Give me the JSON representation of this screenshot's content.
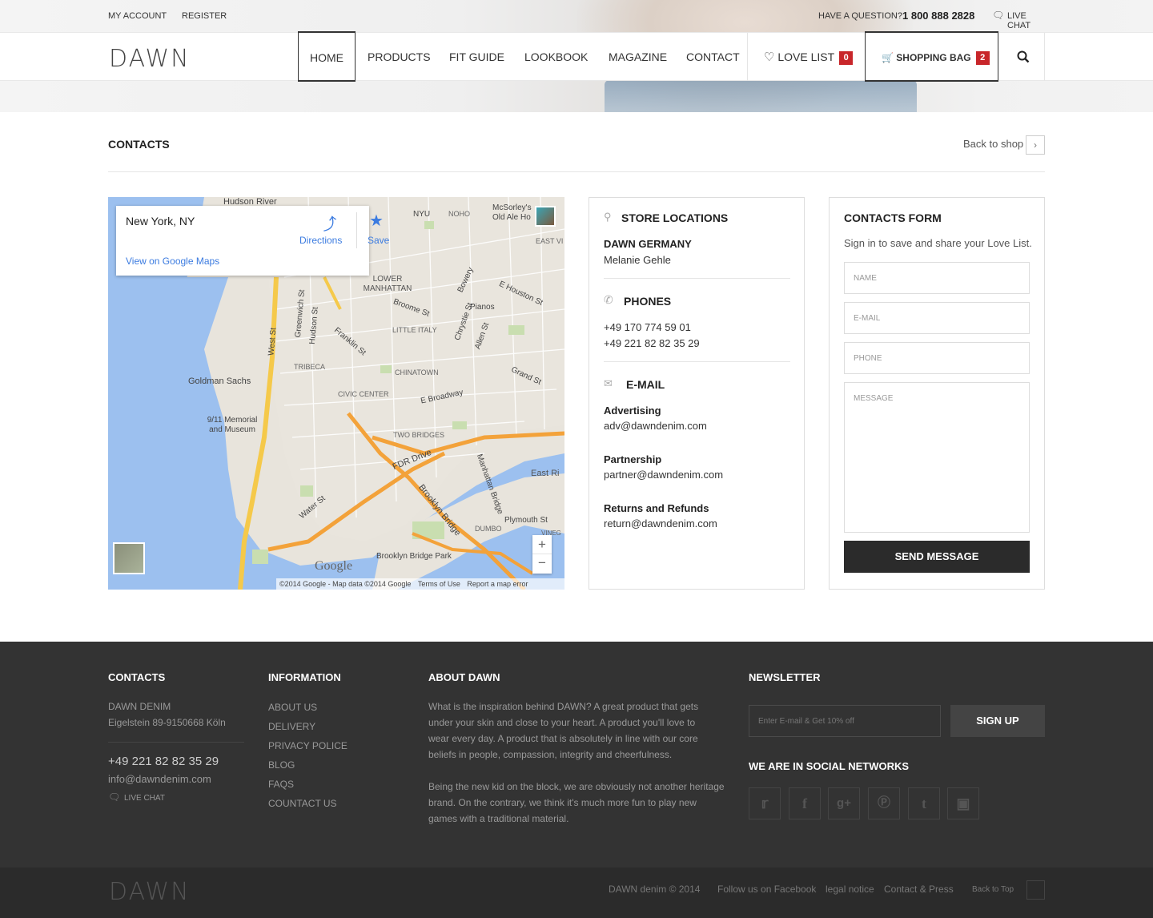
{
  "topbar": {
    "my_account": "MY ACCOUNT",
    "register": "REGISTER",
    "question": "HAVE A QUESTION?",
    "phone": "1 800 888 2828",
    "live_chat": "LIVE CHAT"
  },
  "brand": {
    "logo": "DAWN"
  },
  "nav": {
    "home": "HOME",
    "products": "PRODUCTS",
    "fit_guide": "FIT GUIDE",
    "lookbook": "LOOKBOOK",
    "magazine": "MAGAZINE",
    "contact": "CONTACT",
    "love_list": "LOVE LIST",
    "love_count": "0",
    "shopping_bag": "SHOPPING BAG",
    "bag_count": "2"
  },
  "page": {
    "title": "CONTACTS",
    "back_to_shop": "Back to shop"
  },
  "map": {
    "place": "New York, NY",
    "directions": "Directions",
    "save": "Save",
    "view_on_maps": "View on Google Maps",
    "labels": [
      "Hudson River",
      "NYU",
      "NOHO",
      "McSorley's Old Ale Ho",
      "EAST VI",
      "LOWER MANHATTAN",
      "Bowery",
      "E Houston St",
      "Broome St",
      "Pianos",
      "LITTLE ITALY",
      "Chrystie St",
      "Franklin St",
      "Greenwich St",
      "Hudson St",
      "West St",
      "TRIBECA",
      "Allen St",
      "Grand St",
      "Goldman Sachs",
      "CHINATOWN",
      "CIVIC CENTER",
      "E Broadway",
      "9/11 Memorial and Museum",
      "TWO BRIDGES",
      "FDR Drive",
      "Manhattan Bridge",
      "East Ri",
      "Water St",
      "Brooklyn Bridge",
      "Plymouth St",
      "DUMBO",
      "VINEG",
      "Brooklyn Bridge Park",
      "Google"
    ],
    "copyright": "©2014 Google - Map data ©2014 Google",
    "terms": "Terms of Use",
    "report": "Report a map error"
  },
  "stores": {
    "title": "STORE LOCATIONS",
    "name": "DAWN GERMANY",
    "person": "Melanie Gehle",
    "phones_title": "PHONES",
    "phone1": "+49 170 774 59 01",
    "phone2": "+49 221 82 82 35 29",
    "email_title": "E-MAIL",
    "adv_label": "Advertising",
    "adv_email": "adv@dawndenim.com",
    "partner_label": "Partnership",
    "partner_email": "partner@dawndenim.com",
    "returns_label": "Returns and Refunds",
    "returns_email": "return@dawndenim.com"
  },
  "form": {
    "title": "CONTACTS FORM",
    "subtitle": "Sign in to save and share your Love List.",
    "name_ph": "NAME",
    "email_ph": "E-MAIL",
    "phone_ph": "PHONE",
    "message_ph": "MESSAGE",
    "send": "SEND MESSAGE"
  },
  "footer": {
    "contacts_title": "CONTACTS",
    "company": "DAWN DENIM",
    "address": "Eigelstein 89-9150668 Köln",
    "phone": "+49 221 82 82 35 29",
    "email": "info@dawndenim.com",
    "live_chat": "LIVE CHAT",
    "info_title": "INFORMATION",
    "links": [
      "ABOUT US",
      "DELIVERY",
      "PRIVACY POLICE",
      "BLOG",
      "FAQS",
      "COUNTACT US"
    ],
    "about_title": "ABOUT DAWN",
    "about_p1": "What is the inspiration behind DAWN? A great product that gets under your skin and close to your heart. A product you'll love to wear every day. A product that is absolutely in line with our core beliefs in people, compassion, integrity and cheerfulness.",
    "about_p2": "Being the new kid on the block, we are obviously not another heritage brand. On the contrary, we think it's much more fun to play new games with a traditional material.",
    "newsletter_title": "NEWSLETTER",
    "newsletter_ph": "Enter E-mail & Get 10% off",
    "signup": "SIGN UP",
    "social_title": "WE ARE IN SOCIAL NETWORKS"
  },
  "bottom": {
    "logo": "DAWN",
    "copyright": "DAWN denim © 2014",
    "facebook": "Follow us on Facebook",
    "legal": "legal notice",
    "contact": "Contact & Press",
    "top": "Back to Top"
  },
  "colors": {
    "accent_red": "#c8262a",
    "dark": "#2b2b2b",
    "footer_bg": "#333333"
  }
}
